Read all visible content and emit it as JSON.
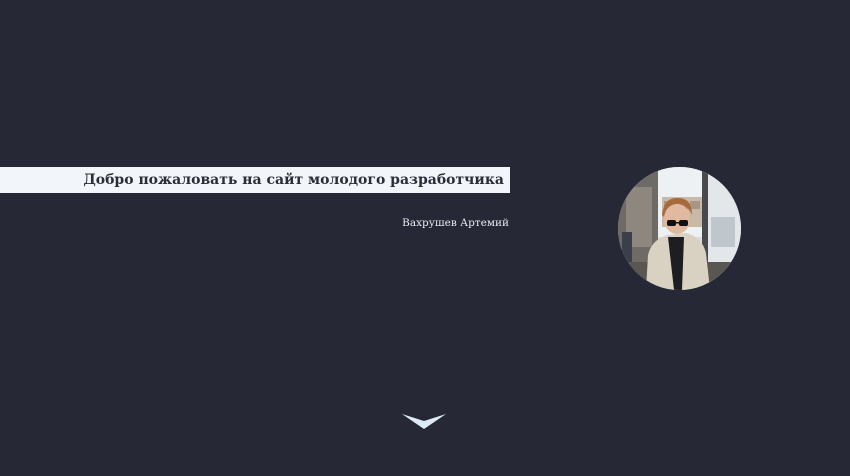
{
  "hero": {
    "title": "Добро пожаловать на сайт молодого разработчика",
    "author": "Вахрушев Артемий"
  },
  "avatar": {
    "icon": "profile-photo"
  },
  "scroll_down": {
    "icon": "chevron-down-icon"
  },
  "colors": {
    "background": "#262835",
    "banner": "#f2f6fa",
    "title_text": "#2a2c38",
    "author_text": "#e8ebf0",
    "chevron": "#dcebf6"
  }
}
